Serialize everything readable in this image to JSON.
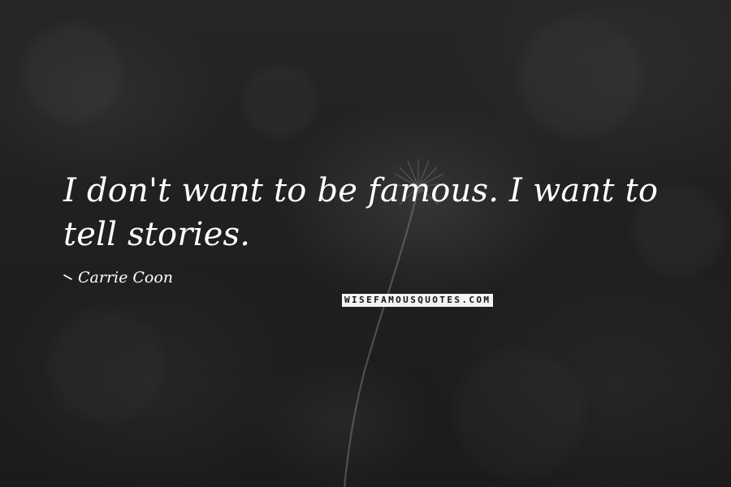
{
  "quote": {
    "text": "I don't want to be famous. I want to tell stories."
  },
  "author": {
    "name": "Carrie Coon",
    "icon": "dash-icon"
  },
  "watermark": {
    "text": "WISEFAMOUSQUOTES.COM"
  },
  "colors": {
    "background": "#202020",
    "text": "#ffffff",
    "watermark_bg": "#f2f2f2",
    "watermark_text": "#111111"
  }
}
